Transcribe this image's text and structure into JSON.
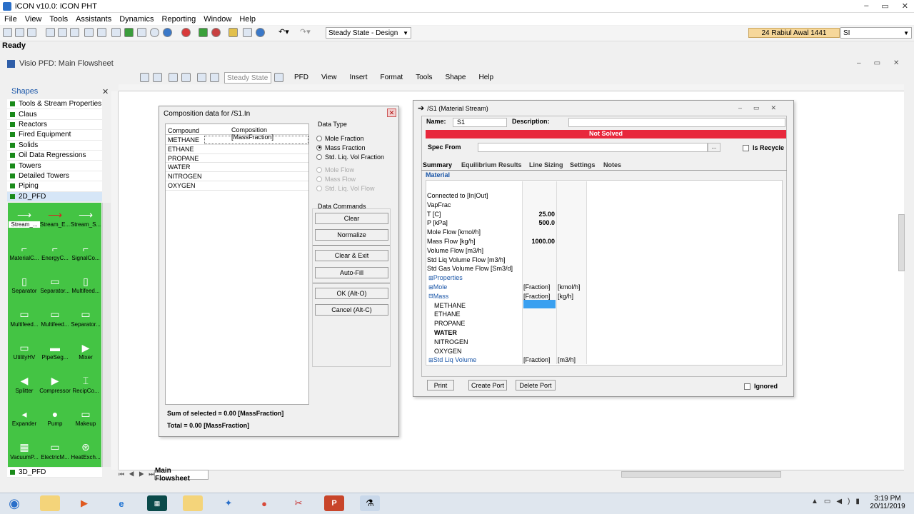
{
  "app": {
    "title": "iCON v10.0: iCON PHT",
    "window_controls": [
      "–",
      "▭",
      "✕"
    ],
    "menu": [
      "File",
      "View",
      "Tools",
      "Assistants",
      "Dynamics",
      "Reporting",
      "Window",
      "Help"
    ],
    "mode_select": "Steady State - Design",
    "date": "24 Rabiul Awal 1441",
    "unit_select": "SI",
    "status": "Ready"
  },
  "visio": {
    "title": "Visio PFD: Main Flowsheet",
    "menu": [
      "PFD",
      "View",
      "Insert",
      "Format",
      "Tools",
      "Shape",
      "Help"
    ],
    "state_field": "Steady State",
    "page_tab": "Main Flowsheet"
  },
  "shapes": {
    "header": "Shapes",
    "categories": [
      "Tools & Stream Properties",
      "Claus",
      "Reactors",
      "Fired Equipment",
      "Solids",
      "Oil Data Regressions",
      "Towers",
      "Detailed Towers",
      "Piping",
      "2D_PFD"
    ],
    "footer": "3D_PFD",
    "stencil": [
      [
        "Stream_...",
        "Stream_E...",
        "Stream_S..."
      ],
      [
        "MaterialC...",
        "EnergyC...",
        "SignalCo..."
      ],
      [
        "Separator",
        "Separator...",
        "Multifeed..."
      ],
      [
        "Multifeed...",
        "Multifeed...",
        "Separator..."
      ],
      [
        "UtilityHV",
        "PipeSeg...",
        "Mixer"
      ],
      [
        "Splitter",
        "Compressor",
        "RecipCo..."
      ],
      [
        "Expander",
        "Pump",
        "Makeup"
      ],
      [
        "VacuumP...",
        "ElectricM...",
        "HeatExch..."
      ]
    ]
  },
  "composition": {
    "title": "Composition data for /S1.In",
    "col_compound": "Compound",
    "col_value": "Composition [MassFraction]",
    "compounds": [
      "METHANE",
      "ETHANE",
      "PROPANE",
      "WATER",
      "NITROGEN",
      "OXYGEN"
    ],
    "data_type_label": "Data Type",
    "data_types": [
      "Mole Fraction",
      "Mass Fraction",
      "Std. Liq. Vol Fraction"
    ],
    "data_types_disabled": [
      "Mole Flow",
      "Mass Flow",
      "Std. Liq. Vol Flow"
    ],
    "commands_label": "Data Commands",
    "buttons": [
      "Clear",
      "Normalize",
      "Clear & Exit",
      "Auto-Fill",
      "OK (Alt-O)",
      "Cancel (Alt-C)"
    ],
    "sum_selected": "Sum of selected = 0.00 [MassFraction]",
    "total": "Total = 0.00 [MassFraction]"
  },
  "stream": {
    "title": "/S1 (Material Stream)",
    "name_label": "Name:",
    "name_value": "S1",
    "desc_label": "Description:",
    "status": "Not Solved",
    "spec_label": "Spec From",
    "is_recycle": "Is Recycle",
    "tabs": [
      "Summary",
      "Equilibrium Results",
      "Line Sizing",
      "Settings",
      "Notes"
    ],
    "section": "Material",
    "rows": [
      {
        "label": "Connected to [In|Out]",
        "v1": "",
        "v2": ""
      },
      {
        "label": "VapFrac",
        "v1": "",
        "v2": ""
      },
      {
        "label": "T [C]",
        "v1": "25.00",
        "v2": ""
      },
      {
        "label": "P [kPa]",
        "v1": "500.0",
        "v2": ""
      },
      {
        "label": "Mole Flow [kmol/h]",
        "v1": "",
        "v2": ""
      },
      {
        "label": "Mass Flow [kg/h]",
        "v1": "1000.00",
        "v2": ""
      },
      {
        "label": "Volume Flow [m3/h]",
        "v1": "",
        "v2": ""
      },
      {
        "label": "Std Liq Volume Flow [m3/h]",
        "v1": "",
        "v2": ""
      },
      {
        "label": "Std Gas Volume Flow [Sm3/d]",
        "v1": "",
        "v2": ""
      },
      {
        "label": "Properties",
        "v1": "",
        "v2": ""
      },
      {
        "label": "Mole",
        "v1": "[Fraction]",
        "v2": "[kmol/h]"
      },
      {
        "label": "Mass",
        "v1": "[Fraction]",
        "v2": "[kg/h]"
      },
      {
        "label": "METHANE",
        "v1": "",
        "v2": ""
      },
      {
        "label": "ETHANE",
        "v1": "",
        "v2": ""
      },
      {
        "label": "PROPANE",
        "v1": "",
        "v2": ""
      },
      {
        "label": "WATER",
        "v1": "",
        "v2": ""
      },
      {
        "label": "NITROGEN",
        "v1": "",
        "v2": ""
      },
      {
        "label": "OXYGEN",
        "v1": "",
        "v2": ""
      },
      {
        "label": "Std Liq Volume",
        "v1": "[Fraction]",
        "v2": "[m3/h]"
      }
    ],
    "buttons": [
      "Print",
      "Create Port",
      "Delete Port"
    ],
    "ignored": "Ignored"
  },
  "taskbar": {
    "time": "3:19 PM",
    "date": "20/11/2019"
  },
  "colors": {
    "not_solved": "#e8283c",
    "stencil_green": "#44c444",
    "link_blue": "#1a56a8"
  }
}
